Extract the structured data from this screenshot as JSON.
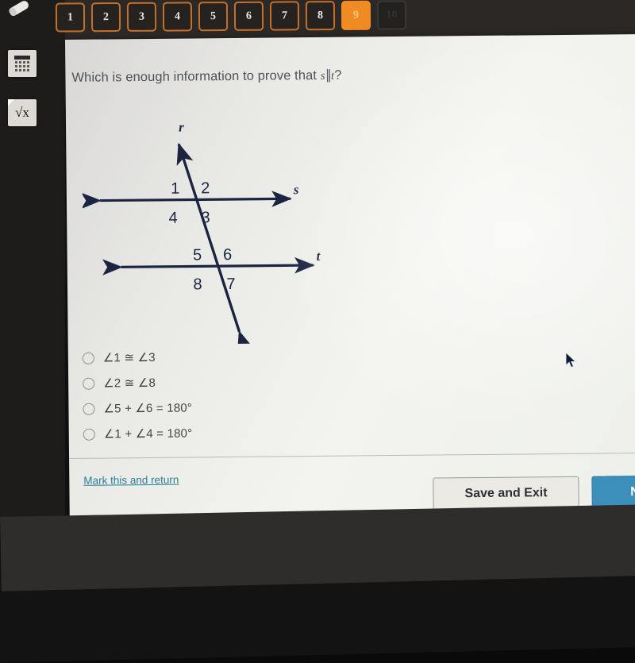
{
  "toolbar": {
    "tools": [
      {
        "name": "pen-eraser-tool",
        "icon": "pen-icon"
      },
      {
        "name": "calculator-tool",
        "icon": "calculator-icon"
      },
      {
        "name": "equation-editor-tool",
        "icon": "square-root-icon",
        "label": "√x"
      }
    ]
  },
  "question_nav": {
    "items": [
      {
        "number": "1",
        "state": "available"
      },
      {
        "number": "2",
        "state": "available"
      },
      {
        "number": "3",
        "state": "available"
      },
      {
        "number": "4",
        "state": "available"
      },
      {
        "number": "5",
        "state": "available"
      },
      {
        "number": "6",
        "state": "available"
      },
      {
        "number": "7",
        "state": "available"
      },
      {
        "number": "8",
        "state": "available"
      },
      {
        "number": "9",
        "state": "active"
      },
      {
        "number": "10",
        "state": "disabled"
      }
    ],
    "active_number": "9",
    "active_color": "#f08a23",
    "border_color": "#c4702a"
  },
  "question": {
    "prefix": "Which is enough information to prove that ",
    "line_a": "s",
    "parallel_symbol": "∥",
    "line_b": "t",
    "suffix": "?",
    "full_text": "Which is enough information to prove that s ∥ t?"
  },
  "figure": {
    "type": "two-parallel-lines-cut-by-transversal",
    "line_labels": {
      "transversal": "r",
      "upper_line": "s",
      "lower_line": "t"
    },
    "angle_labels": {
      "upper_intersection": {
        "top_left": "1",
        "top_right": "2",
        "bottom_right": "3",
        "bottom_left": "4"
      },
      "lower_intersection": {
        "top_left": "5",
        "top_right": "6",
        "bottom_right": "7",
        "bottom_left": "8"
      }
    },
    "stroke_color": "#1b2440"
  },
  "options": [
    {
      "id": "option-1",
      "label": "∠1 ≅ ∠3",
      "selected": false
    },
    {
      "id": "option-2",
      "label": "∠2 ≅ ∠8",
      "selected": false
    },
    {
      "id": "option-3",
      "label": "∠5 + ∠6 = 180°",
      "selected": false
    },
    {
      "id": "option-4",
      "label": "∠1 + ∠4 = 180°",
      "selected": false
    }
  ],
  "footer": {
    "mark_return_label": "Mark this and return",
    "save_exit_label": "Save and Exit",
    "next_label": "Next",
    "link_color": "#2a7f96",
    "next_color": "#3b8fba"
  }
}
